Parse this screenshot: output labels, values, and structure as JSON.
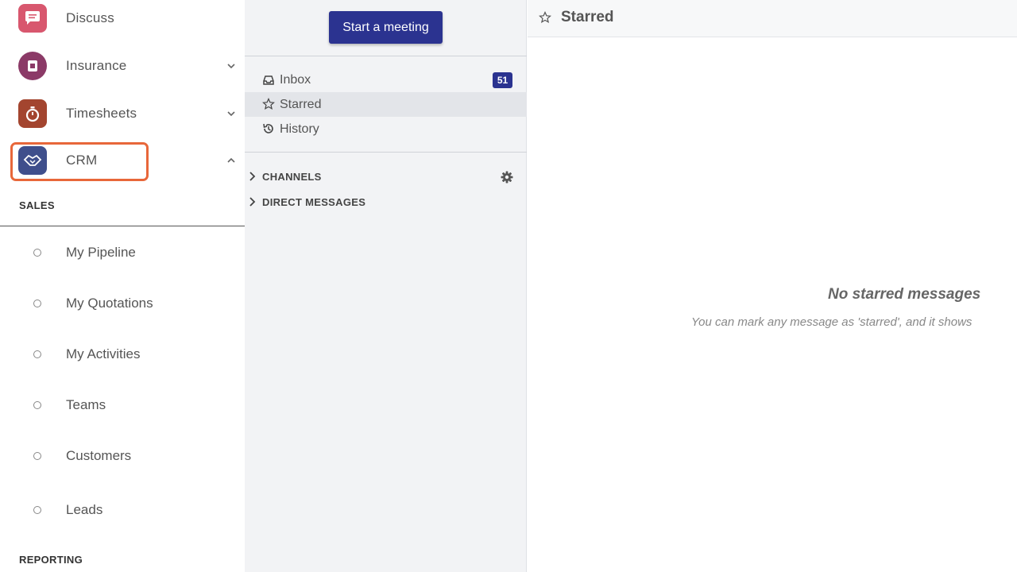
{
  "apps": [
    {
      "label": "Discuss",
      "icon": "discuss-icon",
      "color": "#d8576e",
      "chevron": ""
    },
    {
      "label": "Insurance",
      "icon": "insurance-icon",
      "color": "#8b3a67",
      "chevron": "down"
    },
    {
      "label": "Timesheets",
      "icon": "stopwatch-icon",
      "color": "#a3452f",
      "chevron": "down"
    },
    {
      "label": "CRM",
      "icon": "handshake-icon",
      "color": "#3f4f8c",
      "chevron": "up"
    }
  ],
  "sales_section": {
    "heading": "SALES",
    "items": [
      "My Pipeline",
      "My Quotations",
      "My Activities",
      "Teams",
      "Customers",
      "Leads"
    ]
  },
  "reporting_section": {
    "heading": "REPORTING"
  },
  "discuss": {
    "start_meeting_label": "Start a meeting",
    "mailboxes": [
      {
        "label": "Inbox",
        "icon": "inbox-icon",
        "badge": "51"
      },
      {
        "label": "Starred",
        "icon": "star-icon",
        "active": true
      },
      {
        "label": "History",
        "icon": "history-icon"
      }
    ],
    "categories": [
      {
        "label": "CHANNELS"
      },
      {
        "label": "DIRECT MESSAGES"
      }
    ]
  },
  "main": {
    "title": "Starred",
    "empty_title": "No starred messages",
    "empty_text": "You can mark any message as 'starred', and it shows"
  },
  "colors": {
    "accent": "#2b3390",
    "highlight": "#e8673a",
    "sidebar_bg": "#f2f3f5"
  }
}
